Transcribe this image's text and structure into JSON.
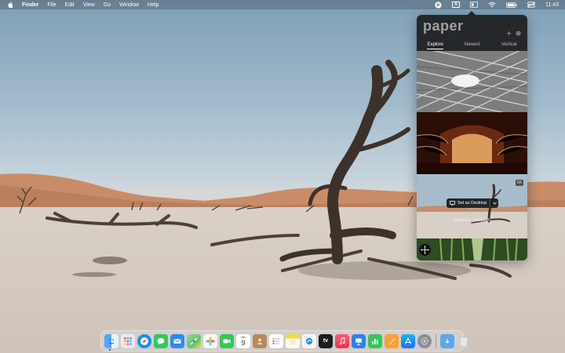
{
  "menubar": {
    "app_name": "Finder",
    "menus": [
      "File",
      "Edit",
      "View",
      "Go",
      "Window",
      "Help"
    ],
    "input_source": "A",
    "clock": "11:43",
    "status_icons": [
      "paper-status-icon",
      "input-source-icon",
      "control-icon",
      "wifi-icon",
      "battery-icon",
      "control-center-icon"
    ]
  },
  "popover": {
    "logo": "paper",
    "tabs": [
      {
        "label": "Explore",
        "active": true
      },
      {
        "label": "Newest",
        "active": false
      },
      {
        "label": "Vertical",
        "active": false
      }
    ],
    "selected_photo": {
      "resolution_badge": "5K",
      "set_button": "Set as Desktop",
      "credit": "@Alex Lo / Unsplash"
    },
    "thumbnails": [
      "architecture-lattice-photo",
      "concert-hall-photo",
      "desert-tree-photo",
      "bamboo-forest-photo"
    ]
  },
  "dock": {
    "apps": [
      {
        "name": "finder",
        "color": "#2f8bf5"
      },
      {
        "name": "launchpad",
        "color": "#e9e9ee"
      },
      {
        "name": "safari",
        "color": "#1d8cf0"
      },
      {
        "name": "messages",
        "color": "#35c759"
      },
      {
        "name": "mail",
        "color": "#2f88f4"
      },
      {
        "name": "maps",
        "color": "#5ec46b"
      },
      {
        "name": "photos",
        "color": "#f6f6f6"
      },
      {
        "name": "facetime",
        "color": "#34c759"
      },
      {
        "name": "calendar",
        "color": "#ffffff"
      },
      {
        "name": "contacts",
        "color": "#b8895a"
      },
      {
        "name": "reminders",
        "color": "#fafafa"
      },
      {
        "name": "notes",
        "color": "#ffd43b"
      },
      {
        "name": "freeform",
        "color": "#f4f4f4"
      },
      {
        "name": "apple-tv",
        "color": "#1c1c1e"
      },
      {
        "name": "music",
        "color": "#fa3d55"
      },
      {
        "name": "keynote",
        "color": "#2c84f0"
      },
      {
        "name": "numbers",
        "color": "#35c759"
      },
      {
        "name": "pages",
        "color": "#f8a13a"
      },
      {
        "name": "app-store",
        "color": "#1a8df5"
      },
      {
        "name": "system-settings",
        "color": "#8e8e93"
      }
    ],
    "calendar_month": "JUL",
    "calendar_day": "9",
    "tv_label": "tv",
    "after_separator": [
      {
        "name": "downloads-folder",
        "color": "#5aa8e8"
      },
      {
        "name": "trash",
        "color": "#d4d8dc"
      }
    ]
  }
}
